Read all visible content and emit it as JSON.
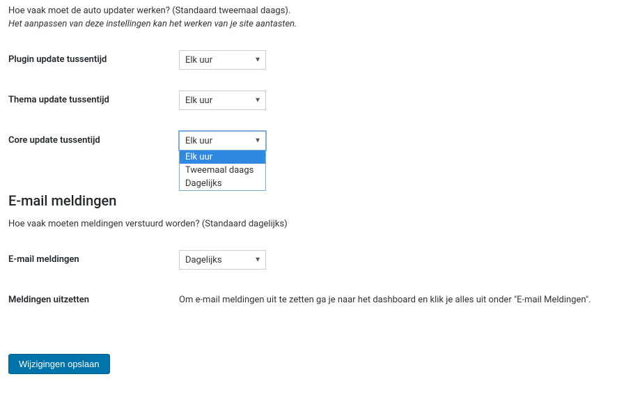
{
  "intro": {
    "text": "Hoe vaak moet de auto updater werken? (Standaard tweemaal daags).",
    "warning": "Het aanpassen van deze instellingen kan het werken van je site aantasten."
  },
  "fields": {
    "plugin_interval": {
      "label": "Plugin update tussentijd",
      "value": "Elk uur"
    },
    "theme_interval": {
      "label": "Thema update tussentijd",
      "value": "Elk uur"
    },
    "core_interval": {
      "label": "Core update tussentijd",
      "value": "Elk uur",
      "options": [
        "Elk uur",
        "Tweemaal daags",
        "Dagelijks"
      ]
    }
  },
  "email_section": {
    "heading": "E-mail meldingen",
    "description": "Hoe vaak moeten meldingen verstuurd worden? (Standaard dagelijks)",
    "field_label": "E-mail meldingen",
    "field_value": "Dagelijks",
    "disable_label": "Meldingen uitzetten",
    "disable_text": "Om e-mail meldingen uit te zetten ga je naar het dashboard en klik je alles uit onder \"E-mail Meldingen\"."
  },
  "save_button": "Wijzigingen opslaan"
}
